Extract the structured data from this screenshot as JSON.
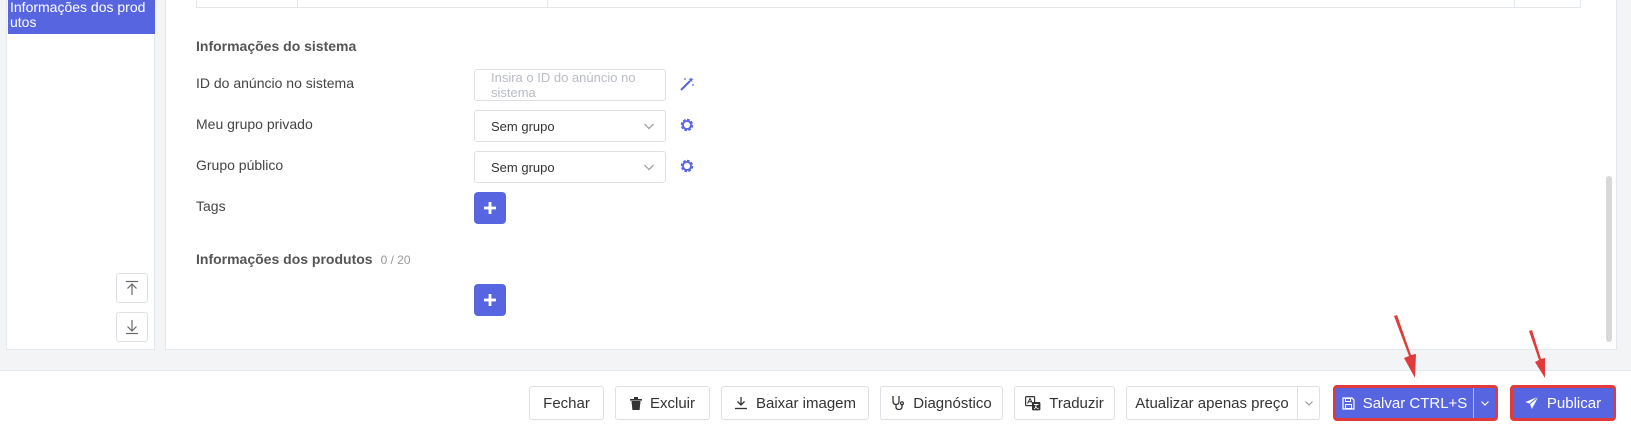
{
  "sidebar": {
    "active_item_label": "Informações dos produtos",
    "scroll_top_icon": "arrow-to-top-icon",
    "scroll_bottom_icon": "arrow-to-bottom-icon"
  },
  "system_info": {
    "title": "Informações do sistema",
    "ad_id_label": "ID do anúncio no sistema",
    "ad_id_placeholder": "Insira o ID do anúncio no sistema",
    "private_group_label": "Meu grupo privado",
    "private_group_value": "Sem grupo",
    "public_group_label": "Grupo público",
    "public_group_value": "Sem grupo",
    "tags_label": "Tags"
  },
  "product_info": {
    "title": "Informações dos produtos",
    "count": "0 / 20"
  },
  "footer": {
    "close_label": "Fechar",
    "delete_label": "Excluir",
    "download_image_label": "Baixar imagem",
    "diagnostic_label": "Diagnóstico",
    "translate_label": "Traduzir",
    "update_price_label": "Atualizar apenas preço",
    "save_label": "Salvar CTRL+S",
    "publish_label": "Publicar"
  },
  "colors": {
    "primary": "#5865e0",
    "highlight": "#e03a3a"
  }
}
